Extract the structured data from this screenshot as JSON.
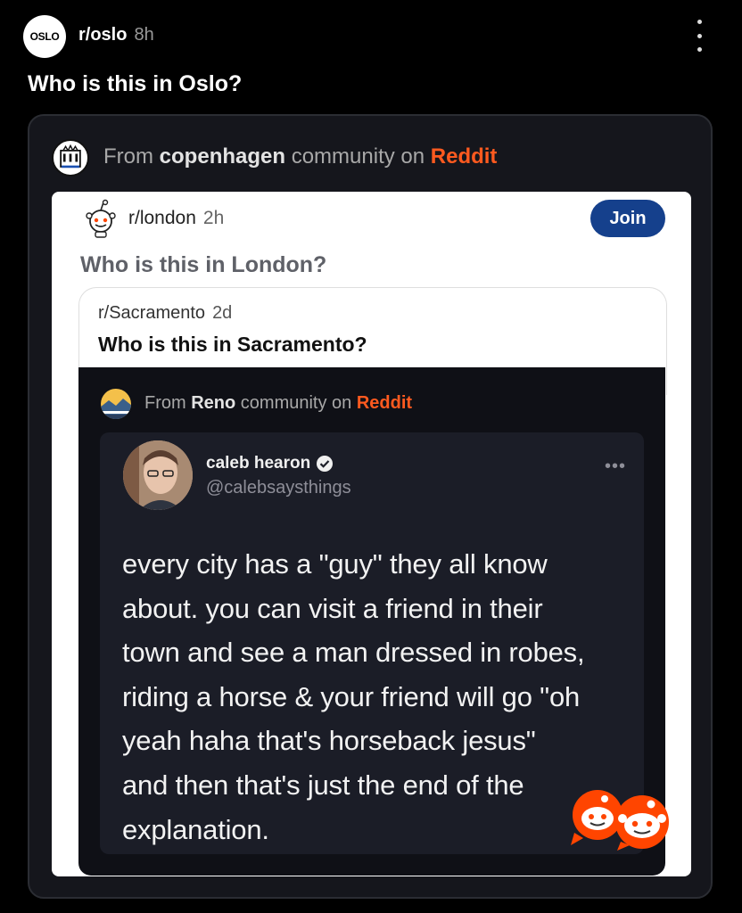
{
  "post": {
    "avatar_text": "OSLO",
    "subreddit": "r/oslo",
    "age": "8h",
    "title": "Who is this in Oslo?",
    "menu_icon": "kebab-vertical-icon"
  },
  "embed": {
    "from_prefix": "From",
    "community": "copenhagen",
    "community_suffix": "community on",
    "platform": "Reddit",
    "shared_post": {
      "subreddit": "r/london",
      "age": "2h",
      "join_label": "Join",
      "title": "Who is this in London?",
      "quoted_post": {
        "subreddit": "r/Sacramento",
        "age": "2d",
        "title": "Who is this in Sacramento?"
      },
      "reno_embed": {
        "from_prefix": "From",
        "community": "Reno",
        "community_suffix": "community on",
        "platform": "Reddit",
        "tweet": {
          "name": "caleb hearon",
          "handle": "@calebsaysthings",
          "more": "•••",
          "text": "every city has a \"guy\" they all know\nabout. you can visit a friend in their\ntown and see a man dressed in robes,\nriding a horse & your friend will go \"oh\nyeah haha that's horseback jesus\"\nand then that's just the end of the\nexplanation."
        }
      }
    }
  },
  "colors": {
    "reddit_orange": "#ff5a1f",
    "join_blue": "#15408c",
    "background": "#000000"
  }
}
